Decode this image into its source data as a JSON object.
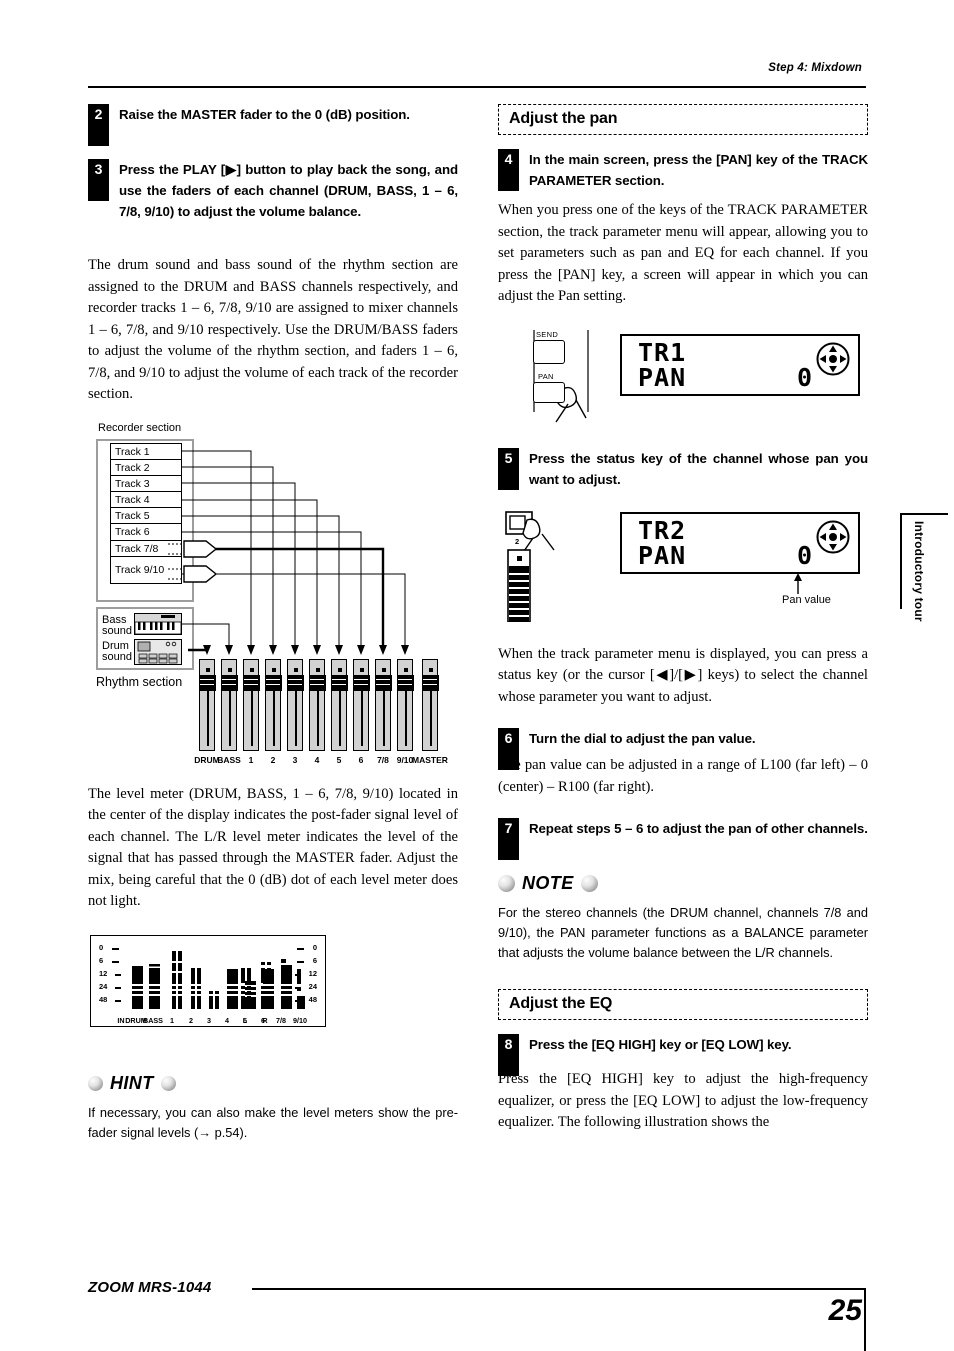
{
  "header": {
    "running_head": "Step 4: Mixdown"
  },
  "left_column": {
    "step2": {
      "number": "2",
      "text": "Raise the MASTER fader to the 0 (dB) position."
    },
    "step3": {
      "number": "3",
      "text": "Press the PLAY [▶] button to play back the song, and use the faders of each channel (DRUM, BASS, 1 – 6, 7/8, 9/10) to adjust the volume balance."
    },
    "para1": "The drum sound and bass sound of the rhythm section are assigned to the DRUM and BASS channels respectively, and recorder tracks 1 – 6, 7/8, 9/10 are assigned to mixer channels 1 – 6, 7/8, and 9/10 respectively. Use the DRUM/BASS faders to adjust the volume of the rhythm section, and faders 1 – 6, 7/8, and 9/10 to adjust the volume of each track of the recorder section.",
    "para2": "The level meter (DRUM, BASS, 1 – 6, 7/8, 9/10) located in the center of the display indicates the post-fader signal level of each channel. The L/R level meter indicates the level of the signal that has passed through the MASTER fader. Adjust the mix, being careful that the 0 (dB) dot of each level meter does not light.",
    "hint": {
      "label": "HINT",
      "text": "If necessary, you can also make the level meters show the pre-fader signal levels (→ p.54)."
    },
    "flow_diagram": {
      "caption_recorder": "Recorder section",
      "caption_rhythm": "Rhythm section",
      "tracks": [
        "Track 1",
        "Track 2",
        "Track 3",
        "Track 4",
        "Track 5",
        "Track 6",
        "Track 7/8",
        "Track 9/10"
      ],
      "bass_label": "Bass\nsound",
      "bass_label_line1": "Bass",
      "bass_label_line2": "sound",
      "drum_label_line1": "Drum",
      "drum_label_line2": "sound",
      "fader_labels": [
        "DRUM",
        "BASS",
        "1",
        "2",
        "3",
        "4",
        "5",
        "6",
        "7/8",
        "9/10",
        "MASTER"
      ]
    },
    "level_meter": {
      "scale_left": [
        "0",
        "6",
        "12",
        "24",
        "48"
      ],
      "scale_right": [
        "0",
        "6",
        "12",
        "24",
        "48"
      ],
      "channel_labels": [
        "IN",
        "DRUM",
        "BASS",
        "1",
        "2",
        "3",
        "4",
        "5",
        "6",
        "7/8",
        "9/10",
        "L",
        "R"
      ]
    }
  },
  "right_column": {
    "section_pan": {
      "title": "Adjust the pan"
    },
    "step4": {
      "number": "4",
      "text": "In the main screen, press the [PAN] key of the TRACK PARAMETER section."
    },
    "para1": "When you press one of the keys of the TRACK PARAMETER section, the track parameter menu will appear, allowing you to set parameters such as pan and EQ for each channel. If you press the [PAN] key, a screen will appear in which you can adjust the Pan setting.",
    "lcd1": {
      "line1": "TR1",
      "line2": "PAN",
      "value": "0",
      "key_send": "SEND",
      "key_pan": "PAN"
    },
    "step5": {
      "number": "5",
      "text": "Press the status key of the channel whose pan you want to adjust."
    },
    "lcd2": {
      "line1": "TR2",
      "line2": "PAN",
      "value": "0",
      "channel_number": "2",
      "callout": "Pan value"
    },
    "para2": "When the track parameter menu is displayed, you can press a status key (or the cursor [◀]/[▶] keys) to select the channel whose parameter you want to adjust.",
    "step6": {
      "number": "6",
      "text": "Turn the dial to adjust the pan value."
    },
    "para3": "The pan value can be adjusted in a range of L100 (far left) – 0 (center) – R100 (far right).",
    "step7": {
      "number": "7",
      "text": "Repeat steps 5 – 6 to adjust the pan of other channels."
    },
    "note": {
      "label": "NOTE",
      "text": "For the stereo channels (the DRUM channel, channels 7/8 and 9/10), the PAN parameter functions as a BALANCE parameter that adjusts the volume balance between the L/R channels."
    },
    "section_eq": {
      "title": "Adjust the EQ"
    },
    "step8": {
      "number": "8",
      "text": "Press the [EQ HIGH] key or [EQ LOW] key."
    },
    "para4": "Press the [EQ HIGH] key to adjust the high-frequency equalizer, or press the [EQ LOW] to adjust the low-frequency equalizer. The following illustration shows the"
  },
  "side_tab": {
    "label": "Introductory tour"
  },
  "footer": {
    "brand": "ZOOM MRS-1044",
    "page_number": "25"
  }
}
